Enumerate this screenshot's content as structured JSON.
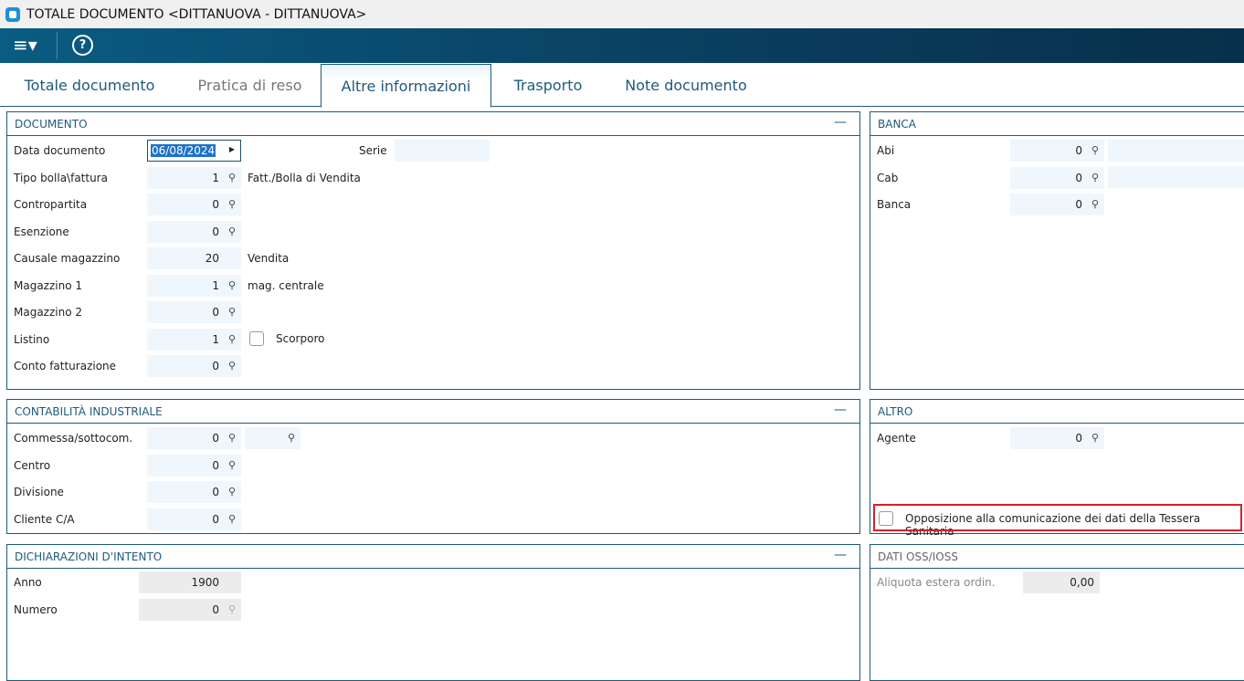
{
  "window": {
    "title": "TOTALE DOCUMENTO <DITTANUOVA - DITTANUOVA>"
  },
  "toolbar": {
    "menu": "≡▾",
    "help": "?"
  },
  "tabs": [
    "Totale documento",
    "Pratica di reso",
    "Altre informazioni",
    "Trasporto",
    "Note documento"
  ],
  "active_tab": 2,
  "documento": {
    "title": "DOCUMENTO",
    "data_label": "Data documento",
    "data_value": "06/08/2024",
    "serie_label": "Serie",
    "serie_value": "",
    "rows": [
      {
        "label": "Tipo bolla\\fattura",
        "value": "1",
        "search": true,
        "desc": "Fatt./Bolla di Vendita"
      },
      {
        "label": "Contropartita",
        "value": "0",
        "search": true,
        "desc": ""
      },
      {
        "label": "Esenzione",
        "value": "0",
        "search": true,
        "desc": ""
      },
      {
        "label": "Causale magazzino",
        "value": "20",
        "search": false,
        "desc": "Vendita"
      },
      {
        "label": "Magazzino 1",
        "value": "1",
        "search": true,
        "desc": "mag. centrale"
      },
      {
        "label": "Magazzino 2",
        "value": "0",
        "search": true,
        "desc": ""
      },
      {
        "label": "Listino",
        "value": "1",
        "search": true,
        "desc": ""
      },
      {
        "label": "Conto fatturazione",
        "value": "0",
        "search": true,
        "desc": ""
      }
    ],
    "scorporo_label": "Scorporo",
    "scorporo_checked": false
  },
  "banca": {
    "title": "BANCA",
    "rows": [
      {
        "label": "Abi",
        "value": "0",
        "search": true
      },
      {
        "label": "Cab",
        "value": "0",
        "search": true
      },
      {
        "label": "Banca",
        "value": "0",
        "search": true
      }
    ]
  },
  "contabilita": {
    "title": "CONTABILITÀ INDUSTRIALE",
    "rows": [
      {
        "label": "Commessa/sottocom.",
        "value": "0",
        "search": true
      },
      {
        "label": "Centro",
        "value": "0",
        "search": true
      },
      {
        "label": "Divisione",
        "value": "0",
        "search": true
      },
      {
        "label": "Cliente C/A",
        "value": "0",
        "search": true
      }
    ]
  },
  "altro": {
    "title": "ALTRO",
    "rows": [
      {
        "label": "Agente",
        "value": "0",
        "search": true
      }
    ],
    "opposizione_label": "Opposizione alla comunicazione dei dati della Tessera Sanitaria",
    "opposizione_checked": false
  },
  "dichiarazioni": {
    "title": "DICHIARAZIONI D'INTENTO",
    "rows": [
      {
        "label": "Anno",
        "value": "1900",
        "search": false
      },
      {
        "label": "Numero",
        "value": "0",
        "search": true
      }
    ]
  },
  "oss": {
    "title": "DATI OSS/IOSS",
    "rows": [
      {
        "label": "Aliquota estera ordin.",
        "value": "0,00",
        "search": false
      }
    ]
  },
  "icons": {
    "search": "⚲",
    "minimize": "—"
  }
}
